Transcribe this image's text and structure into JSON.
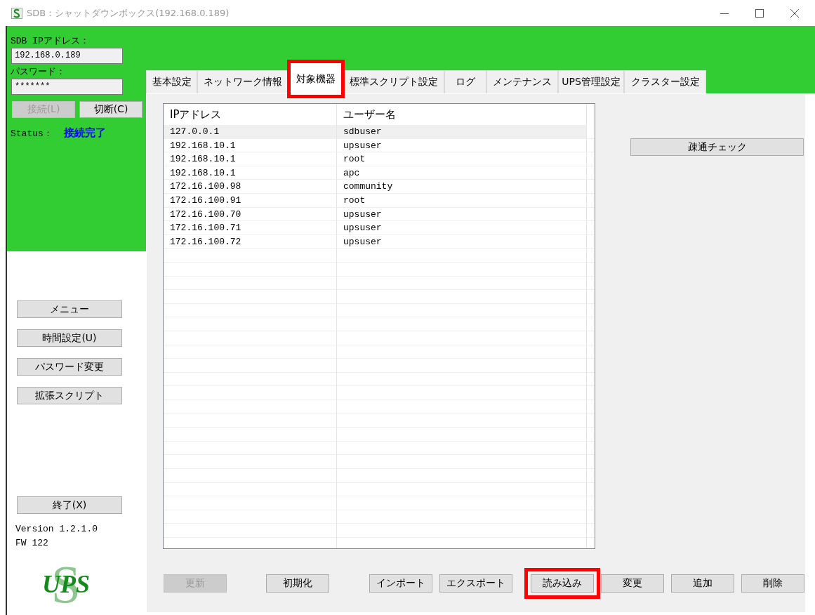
{
  "window": {
    "title": "SDB：シャットダウンボックス(192.168.0.189)"
  },
  "connection": {
    "ip_label": "SDB IPアドレス：",
    "ip_value": "192.168.0.189",
    "password_label": "パスワード：",
    "password_value": "*******",
    "buttons": [
      {
        "label": "接続(L)",
        "disabled": true
      },
      {
        "label": "切断(C)",
        "disabled": false
      }
    ],
    "status_label": "Status：",
    "status_value": "接続完了"
  },
  "side_menu": [
    {
      "label": "メニュー"
    },
    {
      "label": "時間設定(U)"
    },
    {
      "label": "パスワード変更"
    },
    {
      "label": "拡張スクリプト"
    }
  ],
  "exit_button": "終了(X)",
  "version": "Version 1.2.1.0",
  "firmware": "FW 122",
  "logo": {
    "text": "UPS",
    "letter": "S"
  },
  "tabs": [
    {
      "label": "基本設定",
      "selected": false,
      "highlighted": false
    },
    {
      "label": "ネットワーク情報",
      "selected": false,
      "highlighted": false
    },
    {
      "label": "対象機器",
      "selected": true,
      "highlighted": true
    },
    {
      "label": "標準スクリプト設定",
      "selected": false,
      "highlighted": false
    },
    {
      "label": "ログ",
      "selected": false,
      "highlighted": false
    },
    {
      "label": "メンテナンス",
      "selected": false,
      "highlighted": false
    },
    {
      "label": "UPS管理設定",
      "selected": false,
      "highlighted": false
    },
    {
      "label": "クラスター設定",
      "selected": false,
      "highlighted": false
    }
  ],
  "table": {
    "columns": [
      "IPアドレス",
      "ユーザー名"
    ],
    "rows": [
      {
        "ip": "127.0.0.1",
        "user": "sdbuser",
        "selected": true
      },
      {
        "ip": "192.168.10.1",
        "user": "upsuser",
        "selected": false
      },
      {
        "ip": "192.168.10.1",
        "user": "root",
        "selected": false
      },
      {
        "ip": "192.168.10.1",
        "user": "apc",
        "selected": false
      },
      {
        "ip": "172.16.100.98",
        "user": "community",
        "selected": false
      },
      {
        "ip": "172.16.100.91",
        "user": "root",
        "selected": false
      },
      {
        "ip": "172.16.100.70",
        "user": "upsuser",
        "selected": false
      },
      {
        "ip": "172.16.100.71",
        "user": "upsuser",
        "selected": false
      },
      {
        "ip": "172.16.100.72",
        "user": "upsuser",
        "selected": false
      }
    ]
  },
  "check_button": "疎通チェック",
  "actions": [
    {
      "label": "更新",
      "disabled": true,
      "highlighted": false
    },
    {
      "label": "初期化",
      "disabled": false,
      "highlighted": false
    },
    {
      "label": "インポート",
      "disabled": false,
      "highlighted": false
    },
    {
      "label": "エクスポート",
      "disabled": false,
      "highlighted": false
    },
    {
      "label": "読み込み",
      "disabled": false,
      "highlighted": true
    },
    {
      "label": "変更",
      "disabled": false,
      "highlighted": false
    },
    {
      "label": "追加",
      "disabled": false,
      "highlighted": false
    },
    {
      "label": "削除",
      "disabled": false,
      "highlighted": false
    }
  ]
}
